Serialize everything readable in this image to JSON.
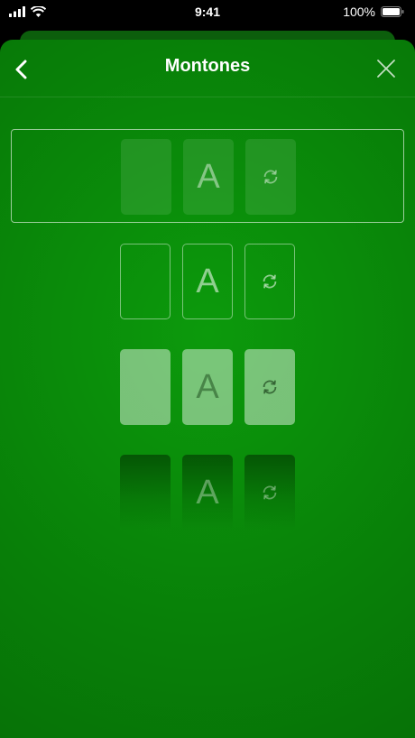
{
  "status_bar": {
    "time": "9:41",
    "battery": "100%"
  },
  "nav": {
    "title": "Montones",
    "back_icon": "chevron-left-icon",
    "close_icon": "close-icon"
  },
  "options": [
    {
      "id": "style-1",
      "selected": true,
      "cards": [
        "",
        "A",
        ""
      ],
      "icons": [
        "",
        "",
        "refresh-icon"
      ]
    },
    {
      "id": "style-2",
      "selected": false,
      "cards": [
        "",
        "A",
        ""
      ],
      "icons": [
        "",
        "",
        "refresh-icon"
      ]
    },
    {
      "id": "style-3",
      "selected": false,
      "cards": [
        "",
        "A",
        ""
      ],
      "icons": [
        "",
        "",
        "refresh-icon"
      ]
    },
    {
      "id": "style-4",
      "selected": false,
      "cards": [
        "",
        "A",
        ""
      ],
      "icons": [
        "",
        "",
        "refresh-icon"
      ]
    }
  ],
  "colors": {
    "background": "#0a8c0a",
    "accent": "#ffffff"
  }
}
